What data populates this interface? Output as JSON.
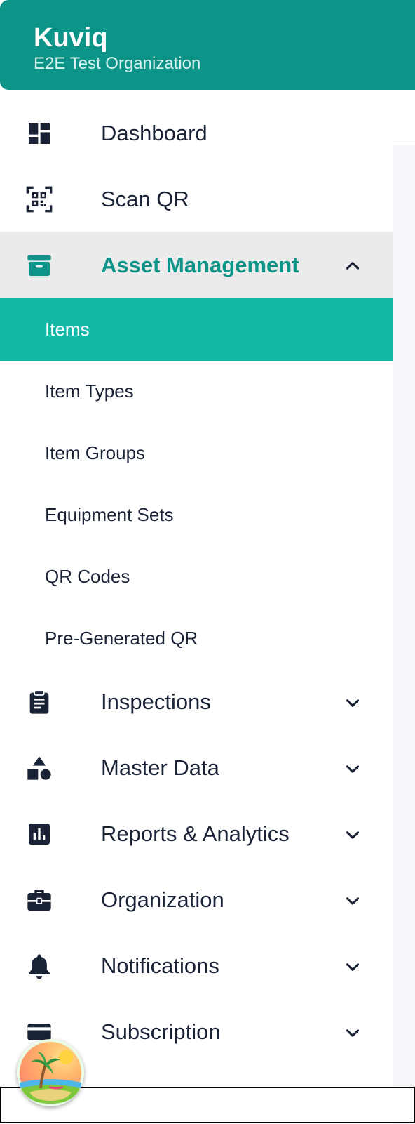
{
  "header": {
    "title": "Kuviq",
    "organization": "E2E Test Organization"
  },
  "nav": {
    "dashboard": {
      "label": "Dashboard",
      "icon": "dashboard-icon"
    },
    "scan_qr": {
      "label": "Scan QR",
      "icon": "qr-code-icon"
    },
    "asset_management": {
      "label": "Asset Management",
      "icon": "archive-box-icon",
      "expanded": true,
      "children": [
        {
          "label": "Items",
          "active": true
        },
        {
          "label": "Item Types"
        },
        {
          "label": "Item Groups"
        },
        {
          "label": "Equipment Sets"
        },
        {
          "label": "QR Codes"
        },
        {
          "label": "Pre-Generated QR"
        }
      ]
    },
    "inspections": {
      "label": "Inspections",
      "icon": "clipboard-icon"
    },
    "master_data": {
      "label": "Master Data",
      "icon": "shapes-icon"
    },
    "reports": {
      "label": "Reports & Analytics",
      "icon": "bar-chart-icon"
    },
    "organization": {
      "label": "Organization",
      "icon": "briefcase-icon"
    },
    "notifications": {
      "label": "Notifications",
      "icon": "bell-icon"
    },
    "subscription": {
      "label": "Subscription",
      "icon": "credit-card-icon"
    }
  },
  "colors": {
    "brand": "#0d9488",
    "active_item": "#14b8a6",
    "expanded_bg": "#ebebeb",
    "text": "#1a2236"
  }
}
